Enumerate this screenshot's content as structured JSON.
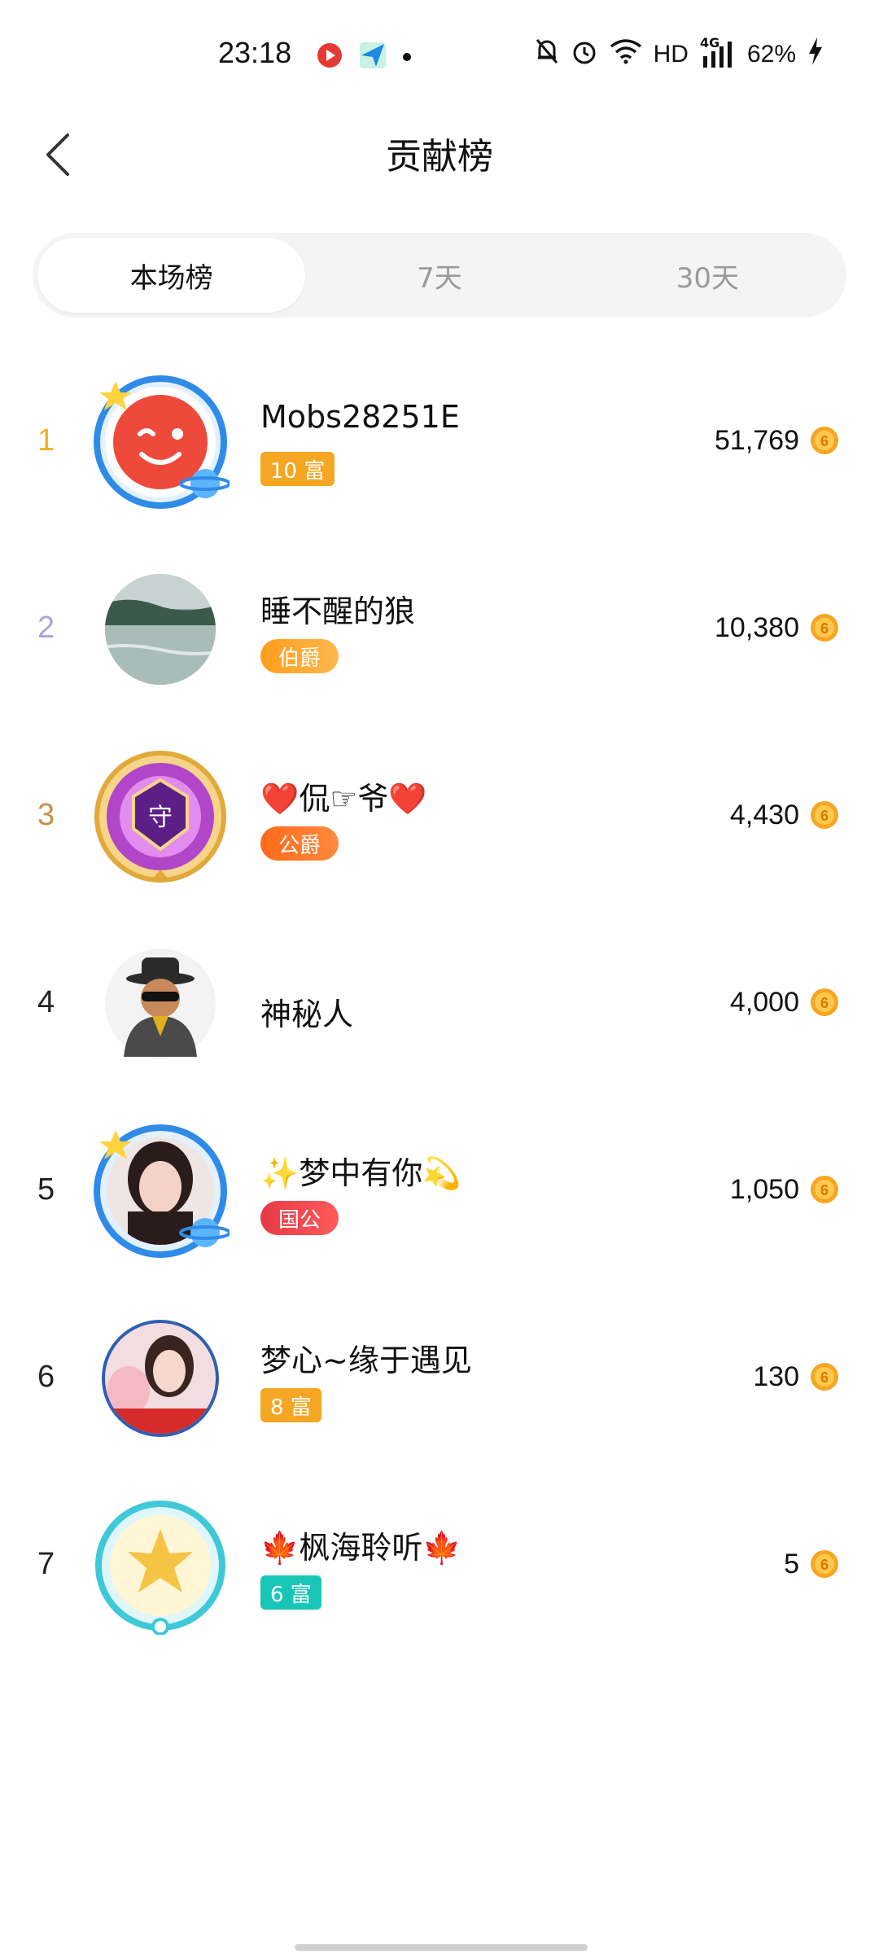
{
  "status_bar": {
    "time": "23:18",
    "network": "HD",
    "signal_label": "4G",
    "battery": "62%"
  },
  "header": {
    "title": "贡献榜",
    "back_icon": "chevron-left-icon"
  },
  "tabs": [
    {
      "label": "本场榜",
      "active": true
    },
    {
      "label": "7天",
      "active": false
    },
    {
      "label": "30天",
      "active": false
    }
  ],
  "leaderboard": [
    {
      "rank": "1",
      "name": "Mobs28251E",
      "badge": "10 富",
      "amount": "51,769"
    },
    {
      "rank": "2",
      "name": "睡不醒的狼",
      "badge": "伯爵",
      "amount": "10,380"
    },
    {
      "rank": "3",
      "name": "❤️侃☞爷❤️",
      "badge": "公爵",
      "amount": "4,430"
    },
    {
      "rank": "4",
      "name": "神秘人",
      "badge": "",
      "amount": "4,000"
    },
    {
      "rank": "5",
      "name": "✨梦中有你💫",
      "badge": "国公",
      "amount": "1,050"
    },
    {
      "rank": "6",
      "name": "梦心~缘于遇见",
      "badge": "8 富",
      "amount": "130"
    },
    {
      "rank": "7",
      "name": "🍁枫海聆听🍁",
      "badge": "6 富",
      "amount": "5"
    }
  ],
  "colors": {
    "gold_rank": "#f0b020",
    "silver_rank": "#a6a6d8",
    "bronze_rank": "#c8914a",
    "coin": "#f5a623",
    "tab_bg": "#f4f4f4"
  }
}
